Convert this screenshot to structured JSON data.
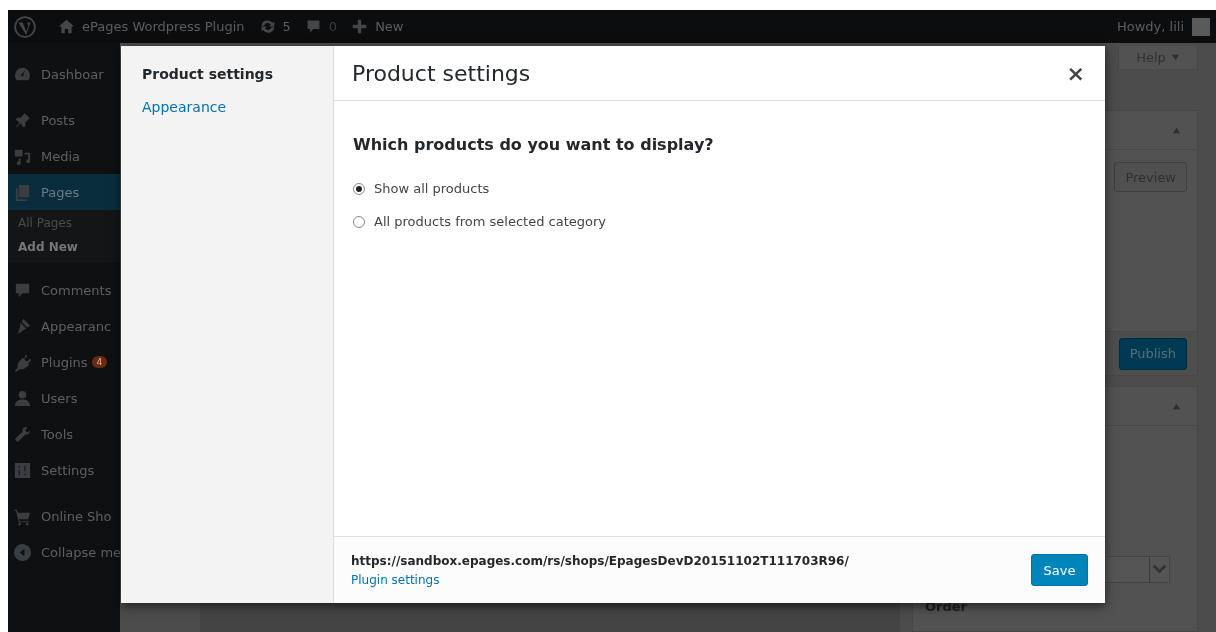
{
  "admin_bar": {
    "site_name": "ePages Wordpress Plugin",
    "updates": "5",
    "comments": "0",
    "new_label": "New",
    "greeting": "Howdy, lili"
  },
  "sidebar": {
    "items": [
      {
        "label": "Dashboar",
        "selected": false
      },
      {
        "label": "Posts",
        "selected": false
      },
      {
        "label": "Media",
        "selected": false
      },
      {
        "label": "Pages",
        "selected": true,
        "children": [
          {
            "label": "All Pages",
            "selected": false
          },
          {
            "label": "Add New",
            "selected": true
          }
        ]
      },
      {
        "label": "Comments",
        "selected": false
      },
      {
        "label": "Appearanc",
        "selected": false
      },
      {
        "label": "Plugins",
        "selected": false,
        "badge": "4"
      },
      {
        "label": "Users",
        "selected": false
      },
      {
        "label": "Tools",
        "selected": false
      },
      {
        "label": "Settings",
        "selected": false
      },
      {
        "label": "Online Sho",
        "selected": false
      },
      {
        "label": "Collapse me",
        "selected": false
      }
    ]
  },
  "editor_sidebar": {
    "help": "Help",
    "preview": "Preview",
    "publish": "Publish",
    "order_label": "Order"
  },
  "modal": {
    "menu": [
      {
        "label": "Product settings",
        "selected": true
      },
      {
        "label": "Appearance",
        "selected": false
      }
    ],
    "title": "Product settings",
    "close": "×",
    "question": "Which products do you want to display?",
    "options": [
      {
        "label": "Show all products",
        "selected": true
      },
      {
        "label": "All products from selected category",
        "selected": false
      }
    ],
    "shop_url": "https://sandbox.epages.com/rs/shops/EpagesDevD20151102T111703R96/",
    "settings_link": "Plugin settings",
    "save": "Save"
  }
}
